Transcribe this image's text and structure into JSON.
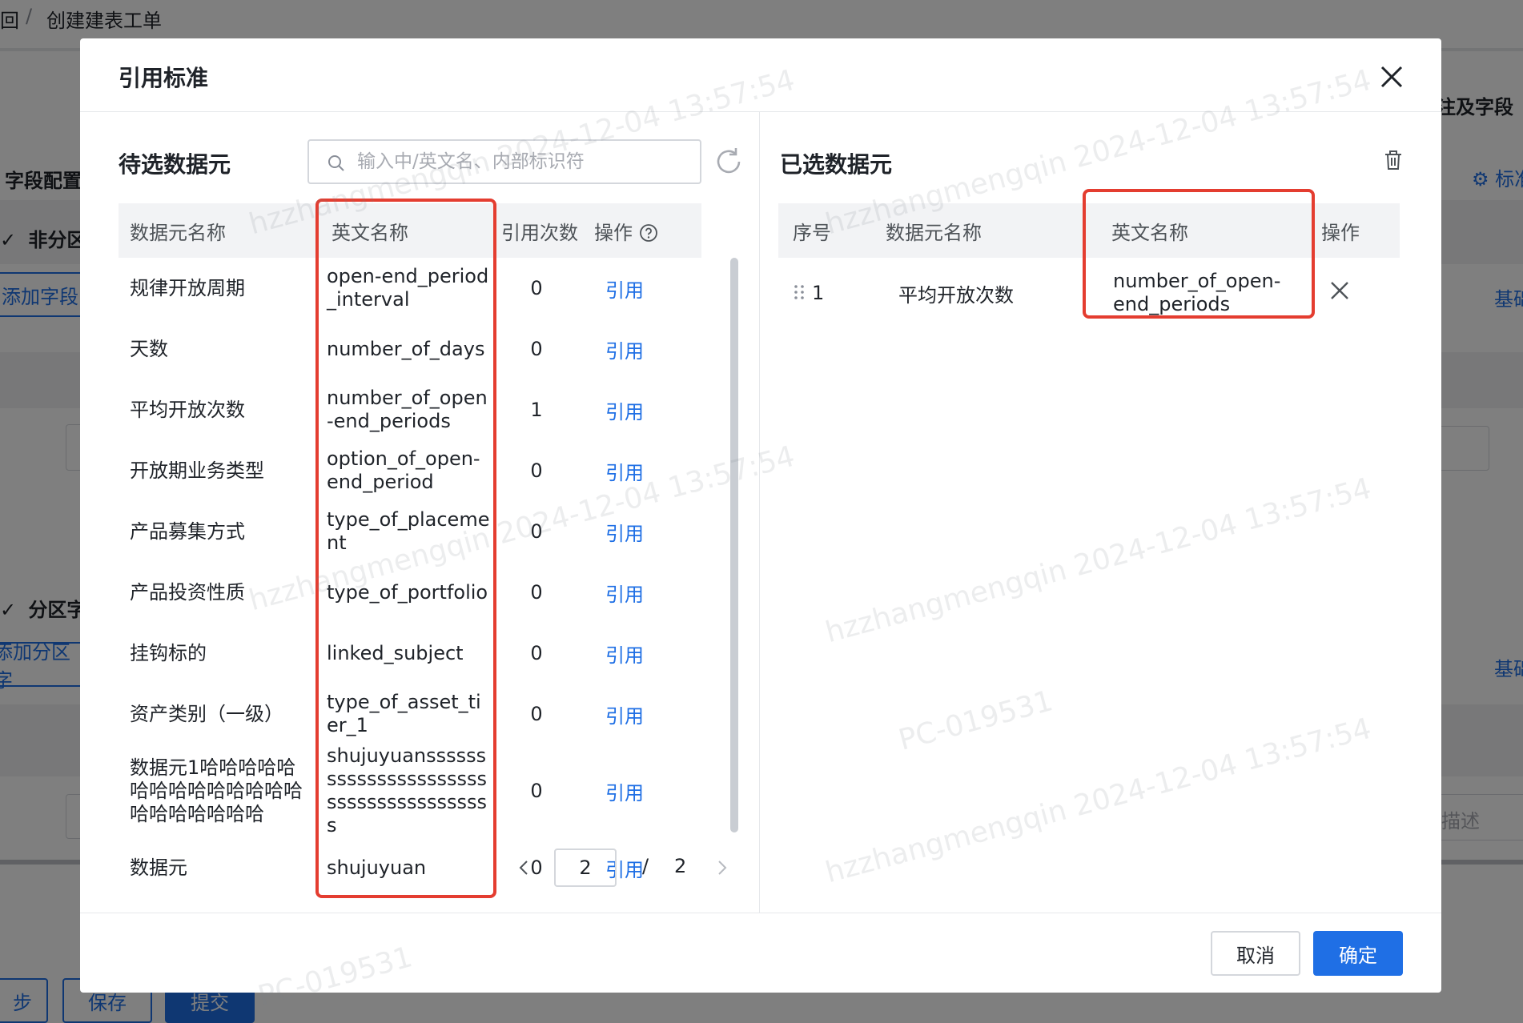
{
  "background": {
    "breadcrumb_prev": "回",
    "breadcrumb_sep": "/",
    "breadcrumb_current": "创建建表工单",
    "field_config": "字段配置",
    "non_partition": "非分区",
    "add_field": "添加字段",
    "partition": "分区字",
    "add_partition": "添加分区字",
    "right_fields": "注及字段",
    "right_std": "标准",
    "right_basic1": "基础",
    "right_basic2": "基础",
    "right_desc": "描述",
    "footer_prev": "步",
    "footer_save": "保存",
    "footer_submit": "提交"
  },
  "modal": {
    "title": "引用标准",
    "cancel_label": "取消",
    "ok_label": "确定"
  },
  "left": {
    "title": "待选数据元",
    "search_placeholder": "输入中/英文名、内部标识符",
    "columns": {
      "name": "数据元名称",
      "en": "英文名称",
      "count": "引用次数",
      "op": "操作"
    },
    "rows": [
      {
        "name": "规律开放周期",
        "en": "open-end_period_interval",
        "count": "0",
        "op": "引用"
      },
      {
        "name": "天数",
        "en": "number_of_days",
        "count": "0",
        "op": "引用"
      },
      {
        "name": "平均开放次数",
        "en": "number_of_open-end_periods",
        "count": "1",
        "op": "引用"
      },
      {
        "name": "开放期业务类型",
        "en": "option_of_open-end_period",
        "count": "0",
        "op": "引用"
      },
      {
        "name": "产品募集方式",
        "en": "type_of_placement",
        "count": "0",
        "op": "引用"
      },
      {
        "name": "产品投资性质",
        "en": "type_of_portfolio",
        "count": "0",
        "op": "引用"
      },
      {
        "name": "挂钩标的",
        "en": "linked_subject",
        "count": "0",
        "op": "引用"
      },
      {
        "name": "资产类别（一级）",
        "en": "type_of_asset_tier_1",
        "count": "0",
        "op": "引用"
      },
      {
        "name": "数据元1哈哈哈哈哈哈哈哈哈哈哈哈哈哈哈哈哈哈哈哈哈",
        "en": "shujuyuansssssssssssssssssssssssssssssssssssssss",
        "count": "0",
        "op": "引用"
      },
      {
        "name": "数据元",
        "en": "shujuyuan",
        "count": "0",
        "op": "引用"
      }
    ],
    "pager": {
      "current": "2",
      "slash": "/",
      "total": "2"
    }
  },
  "right": {
    "title": "已选数据元",
    "columns": {
      "idx": "序号",
      "name": "数据元名称",
      "en": "英文名称",
      "op": "操作"
    },
    "rows": [
      {
        "idx": "1",
        "name": "平均开放次数",
        "en": "number_of_open-end_periods"
      }
    ]
  },
  "watermark": {
    "user": "hzzhangmengqin",
    "time": "2024-12-04 13:57:54",
    "host": "PC-019531"
  },
  "colors": {
    "accent": "#1f6fe5",
    "highlight": "#e43d30"
  }
}
